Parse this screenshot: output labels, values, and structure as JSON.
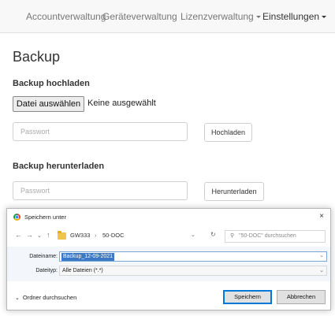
{
  "navbar": {
    "items": [
      {
        "label": "Accountverwaltung"
      },
      {
        "label": "Geräteverwaltung"
      },
      {
        "label": "Lizenzverwaltung"
      },
      {
        "label": "Einstellungen"
      }
    ]
  },
  "page": {
    "title": "Backup",
    "upload": {
      "heading": "Backup hochladen",
      "file_button": "Datei auswählen",
      "file_status": "Keine ausgewählt",
      "password_placeholder": "Passwort",
      "submit": "Hochladen"
    },
    "download": {
      "heading": "Backup herunterladen",
      "password_placeholder": "Passwort",
      "submit": "Herunterladen"
    }
  },
  "dialog": {
    "title": "Speichern unter",
    "close": "×",
    "breadcrumb": [
      "GW333",
      "50-DOC"
    ],
    "search_placeholder": "\"50-DOC\" durchsuchen",
    "filename_label": "Dateiname:",
    "filename_value": "Backup_12-09-2021",
    "filetype_label": "Dateityp:",
    "filetype_value": "Alle Dateien (*.*)",
    "browse_label": "Ordner durchsuchen",
    "save": "Speichern",
    "cancel": "Abbrechen"
  },
  "colors": {
    "selection": "#3b78c6",
    "primary_button_border": "#0078d7",
    "folder": "#f0c24e"
  }
}
